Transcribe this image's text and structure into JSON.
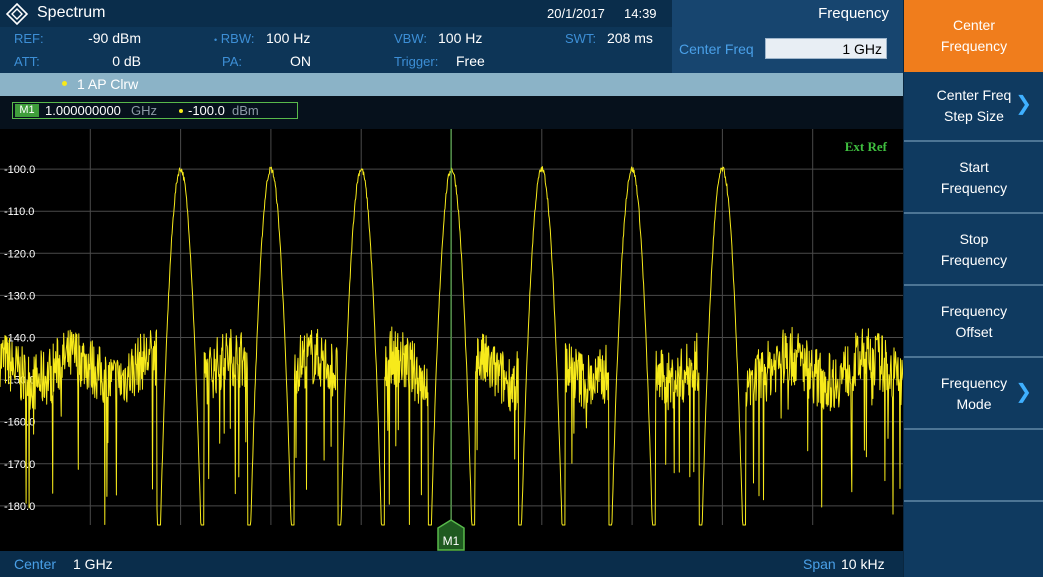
{
  "header": {
    "app_title": "Spectrum",
    "date": "20/1/2017",
    "time": "14:39",
    "icon": "rs-diamond-icon"
  },
  "params": {
    "ref_label": "REF:",
    "ref_value": "-90 dBm",
    "att_label": "ATT:",
    "att_value": "0 dB",
    "rbw_label": "RBW:",
    "rbw_value": "100 Hz",
    "pa_label": "PA:",
    "pa_value": "ON",
    "vbw_label": "VBW:",
    "vbw_value": "100 Hz",
    "trigger_label": "Trigger:",
    "trigger_value": "Free",
    "swt_label": "SWT:",
    "swt_value": "208 ms"
  },
  "freq_panel": {
    "title": "Frequency",
    "center_label": "Center Freq",
    "center_value": "1 GHz"
  },
  "trace": {
    "label": "1 AP Clrw",
    "color": "#f7ea1b"
  },
  "marker": {
    "badge": "M1",
    "freq": "1.000000000",
    "freq_unit": "GHz",
    "level": "-100.0",
    "level_unit": "dBm",
    "plot_label": "M1"
  },
  "plot": {
    "ext_ref": "Ext Ref",
    "y_ticks": [
      "-100.0",
      "-110.0",
      "-120.0",
      "-130.0",
      "-140.0",
      "-150.0",
      "-160.0",
      "-170.0",
      "-180.0"
    ],
    "grid_color": "#4a4a4a",
    "marker_line_color": "#58b94b"
  },
  "footer": {
    "center_label": "Center",
    "center_value": "1 GHz",
    "span_label": "Span",
    "span_value": "10 kHz"
  },
  "softkeys": [
    {
      "label": "Center\nFrequency",
      "active": true,
      "chevron": false
    },
    {
      "label": "Center Freq\nStep Size",
      "active": false,
      "chevron": true
    },
    {
      "label": "Start Frequency",
      "active": false,
      "chevron": false
    },
    {
      "label": "Stop Frequency",
      "active": false,
      "chevron": false
    },
    {
      "label": "Frequency\nOffset",
      "active": false,
      "chevron": false
    },
    {
      "label": "Frequency\nMode",
      "active": false,
      "chevron": true
    },
    {
      "label": "",
      "active": false,
      "chevron": false
    },
    {
      "label": "",
      "active": false,
      "chevron": false
    }
  ],
  "chart_data": {
    "type": "line",
    "xlabel": "",
    "ylabel": "",
    "ylim": [
      -190,
      -90
    ],
    "x_center": "1 GHz",
    "x_span": "10 kHz",
    "grid": true,
    "series": [
      {
        "x_offset_hz": [
          -5000,
          -4000,
          -3000,
          -2000,
          -1000,
          0,
          1000,
          2000,
          3000,
          4000,
          5000
        ],
        "peaks_x_offset_hz": [
          -3000,
          -2000,
          -1000,
          0,
          1000,
          2000,
          3000
        ],
        "peak_level_dbm": -100.0,
        "noise_floor_dbm": [
          -145,
          -150
        ]
      }
    ]
  }
}
